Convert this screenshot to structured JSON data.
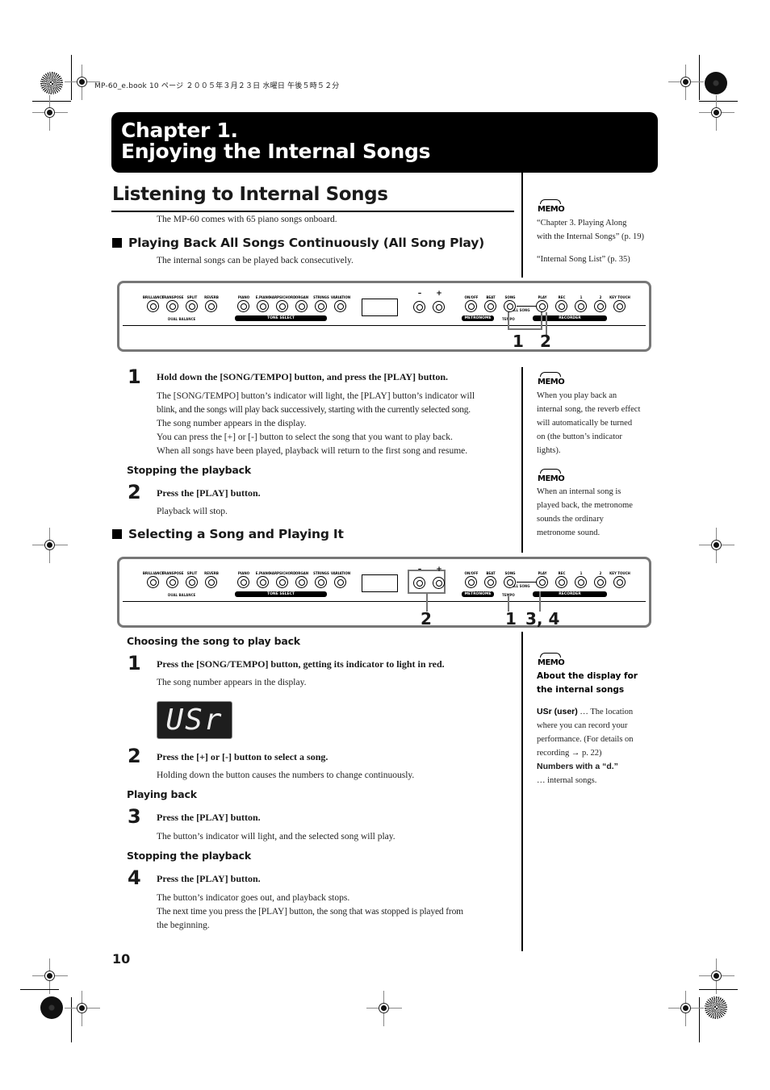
{
  "slug": "MP-60_e.book  10 ページ  ２００５年３月２３日  水曜日  午後５時５２分",
  "chapter": {
    "line1": "Chapter 1.",
    "line2": "Enjoying the Internal Songs"
  },
  "section": {
    "title": "Listening to Internal Songs",
    "intro": "The MP-60 comes with 65 piano songs onboard."
  },
  "all_song_play": {
    "heading": "Playing Back All Songs Continuously (All Song Play)",
    "intro": "The internal songs can be played back consecutively.",
    "steps": [
      {
        "num": "1",
        "title": "Hold down the [SONG/TEMPO] button, and press the [PLAY] button.",
        "body": [
          "The [SONG/TEMPO] button’s indicator will light, the [PLAY] button’s indicator will",
          "blink, and the songs will play back successively, starting with the currently selected song.",
          "The song number appears in the display.",
          "You can press the [+] or [-] button to select the song that you want to play back.",
          "When all songs have been played, playback will return to the first song and resume."
        ]
      },
      {
        "subheading": "Stopping the playback",
        "num": "2",
        "title": "Press the [PLAY] button.",
        "body": [
          "Playback will stop."
        ]
      }
    ]
  },
  "select_play": {
    "heading": "Selecting a Song and Playing It",
    "subheadings": {
      "choosing": "Choosing the song to play back",
      "playing": "Playing back",
      "stopping": "Stopping the playback"
    },
    "display_text": "USr",
    "steps": [
      {
        "num": "1",
        "title": "Press the [SONG/TEMPO] button, getting its indicator to light in red.",
        "body": [
          "The song number appears in the display."
        ]
      },
      {
        "num": "2",
        "title": "Press the [+] or [-] button to select a song.",
        "body": [
          "Holding down the button causes the numbers to change continuously."
        ]
      },
      {
        "num": "3",
        "title": "Press the [PLAY] button.",
        "body": [
          "The button’s indicator will light, and the selected song will play."
        ]
      },
      {
        "num": "4",
        "title": "Press the [PLAY] button.",
        "body": [
          "The button’s indicator goes out, and playback stops.",
          "The next time you press the [PLAY] button, the song that was stopped is played from",
          "the beginning."
        ]
      }
    ]
  },
  "panel": {
    "left_buttons": [
      "BRILLIANCE",
      "TRANSPOSE",
      "SPLIT",
      "REVERB"
    ],
    "tone_buttons": [
      "PIANO",
      "E.PIANO",
      "HARPSICHORD",
      "ORGAN",
      "STRINGS",
      "VARIATION"
    ],
    "value_buttons": [
      "–",
      "+"
    ],
    "metronome_buttons": [
      "ON/OFF",
      "BEAT"
    ],
    "song_button": "SONG",
    "recorder_buttons": [
      "PLAY",
      "REC",
      "1",
      "2"
    ],
    "key_touch": "KEY TOUCH",
    "dual_balance": "DUAL BALANCE",
    "tone_select": "TONE SELECT",
    "metronome": "METRONOME",
    "tempo": "TEMPO",
    "all_song": "ALL SONG",
    "recorder": "RECORDER",
    "callouts_1": [
      "1",
      "2"
    ],
    "callouts_2": [
      "2",
      "1",
      "3, 4"
    ]
  },
  "memos": [
    {
      "icon": "memo-icon",
      "label": "MEMO",
      "lines": [
        "“Chapter 3. Playing Along",
        "with the Internal Songs” (p. 19)",
        "",
        "“Internal Song List” (p. 35)"
      ]
    },
    {
      "icon": "memo-icon",
      "label": "MEMO",
      "lines": [
        "When you play back an",
        "internal song, the reverb effect",
        "will automatically be turned",
        "on (the button’s indicator",
        "lights)."
      ]
    },
    {
      "icon": "memo-icon",
      "label": "MEMO",
      "lines": [
        "When an internal song is",
        "played back, the metronome",
        "sounds the ordinary",
        "metronome sound."
      ]
    },
    {
      "icon": "memo-icon",
      "label": "MEMO",
      "title": "About the display for the internal songs",
      "usr_term": "USr (user)",
      "usr_text": " … The location",
      "usr_lines": [
        "where you can record your",
        "performance. (For details on",
        "recording → p. 22)"
      ],
      "numbers_term": "Numbers with a “d.”",
      "numbers_text": "… internal songs."
    }
  ],
  "page_number": "10"
}
